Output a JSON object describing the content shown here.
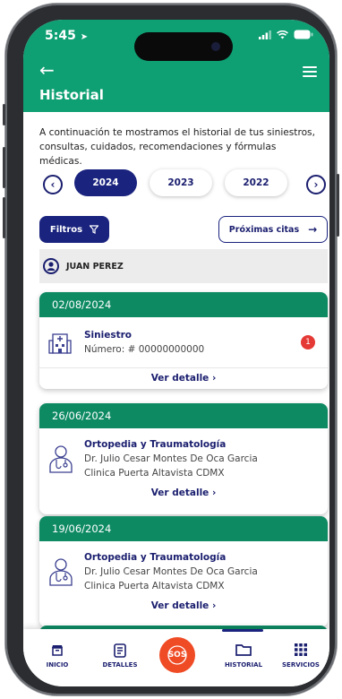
{
  "status": {
    "time": "5:45"
  },
  "header": {
    "title": "Historial"
  },
  "intro": "A continuación te mostramos el historial de  tus siniestros, consultas, cuidados, recomendaciones y fórmulas médicas.",
  "years": [
    "2024",
    "2023",
    "2022"
  ],
  "filters": {
    "filtros_label": "Filtros",
    "proximas_label": "Próximas citas"
  },
  "user": {
    "name": "JUAN PEREZ"
  },
  "records": [
    {
      "date": "02/08/2024",
      "title": "Siniestro",
      "line1": "Número: # 00000000000",
      "badge": "1",
      "action": "Ver detalle"
    },
    {
      "date": "26/06/2024",
      "title": "Ortopedia y Traumatología",
      "line1": "Dr. Julio Cesar Montes De Oca Garcia",
      "line2": "Clinica Puerta Altavista CDMX",
      "action": "Ver detalle"
    },
    {
      "date": "19/06/2024",
      "title": "Ortopedia y Traumatología",
      "line1": "Dr. Julio Cesar Montes De Oca Garcia",
      "line2": "Clinica Puerta Altavista CDMX",
      "action": "Ver detalle"
    }
  ],
  "bottom_nav": {
    "inicio": "INICIO",
    "detalles": "DETALLES",
    "sos": "SOS",
    "historial": "HISTORIAL",
    "servicios": "SERVICIOS"
  },
  "colors": {
    "primary_green": "#0e9f72",
    "card_header_green": "#0e8a63",
    "navy": "#1a237e",
    "sos_orange": "#ef4b25",
    "badge_red": "#e53935"
  },
  "icons": [
    "back-arrow-icon",
    "menu-icon",
    "chevron-left-icon",
    "chevron-right-icon",
    "filter-icon",
    "arrow-right-icon",
    "user-icon",
    "hospital-icon",
    "doctor-icon",
    "home-icon",
    "details-icon",
    "sos-icon",
    "folder-icon",
    "grid-icon"
  ]
}
